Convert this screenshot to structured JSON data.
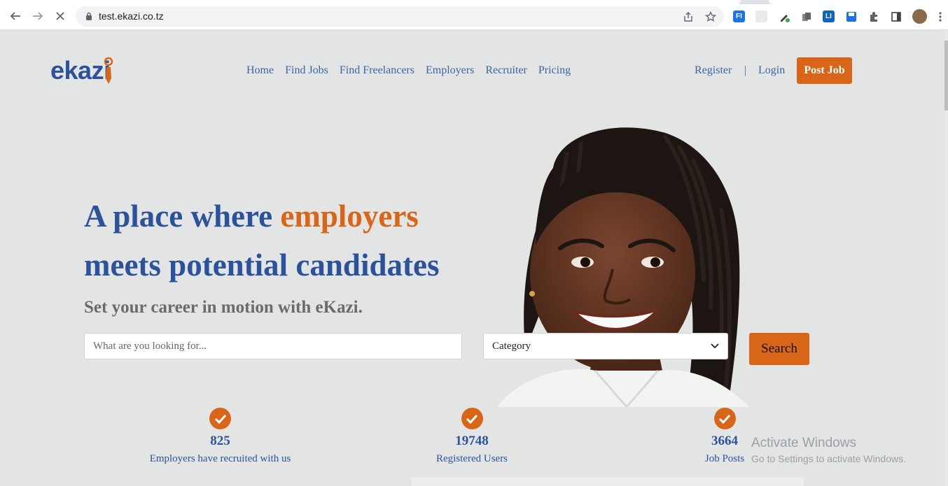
{
  "browser": {
    "url": "test.ekazi.co.tz",
    "back_icon": "arrow-left-icon",
    "forward_icon": "arrow-right-icon",
    "stop_icon": "close-icon",
    "extensions": [
      "FI",
      "LI"
    ]
  },
  "site": {
    "logo_text": "ekazi",
    "nav": [
      {
        "label": "Home"
      },
      {
        "label": "Find Jobs"
      },
      {
        "label": "Find Freelancers"
      },
      {
        "label": "Employers"
      },
      {
        "label": "Recruiter"
      },
      {
        "label": "Pricing"
      }
    ],
    "register_label": "Register",
    "separator": "|",
    "login_label": "Login",
    "post_job_label": "Post Job"
  },
  "hero": {
    "headline_part1": "A place where ",
    "headline_accent": "employers",
    "headline_part2": "meets potential candidates",
    "subheadline": "Set your career in motion with eKazi.",
    "search_placeholder": "What are you looking for...",
    "category_value": "Category",
    "search_button": "Search"
  },
  "stats": [
    {
      "number": "825",
      "label": "Employers have recruited with us"
    },
    {
      "number": "19748",
      "label": "Registered Users"
    },
    {
      "number": "3664",
      "label": "Job Posts"
    }
  ],
  "watermark": {
    "title": "Activate Windows",
    "subtitle": "Go to Settings to activate Windows."
  },
  "colors": {
    "brand_blue": "#2c529b",
    "brand_orange": "#d96518",
    "page_bg": "#e2e5e3"
  }
}
